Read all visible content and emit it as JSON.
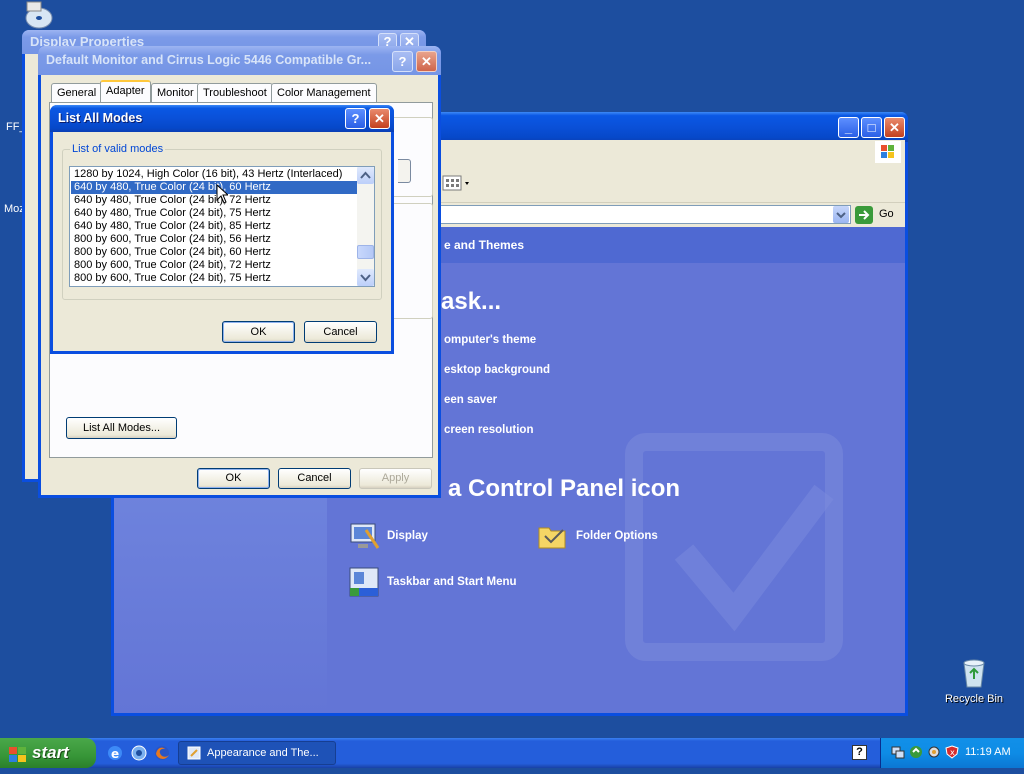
{
  "desktop": {
    "icons": [
      {
        "name": "recycle-bin",
        "label": "Recycle Bin"
      }
    ],
    "side_texts": [
      "FF_",
      "Moz"
    ]
  },
  "control_panel": {
    "window_buttons": [
      "_",
      "□",
      "✕"
    ],
    "address_go": "Go",
    "header": "e and Themes",
    "pick_task": "task...",
    "tasks": [
      "omputer's theme",
      "esktop background",
      "een saver",
      "creen resolution"
    ],
    "pick_icon": "a Control Panel icon",
    "icons": [
      {
        "label": "Display"
      },
      {
        "label": "Folder Options"
      },
      {
        "label": "Taskbar and Start Menu"
      }
    ]
  },
  "display_properties": {
    "title": "Display Properties"
  },
  "monitor_dialog": {
    "title": "Default Monitor and Cirrus Logic 5446 Compatible Gr...",
    "tabs": [
      "General",
      "Adapter",
      "Monitor",
      "Troubleshoot",
      "Color Management"
    ],
    "selected_tab": "Adapter",
    "list_all_modes_button": "List All Modes...",
    "ok": "OK",
    "cancel": "Cancel",
    "apply": "Apply"
  },
  "list_modes_dialog": {
    "title": "List All Modes",
    "group_label": "List of valid modes",
    "modes": [
      "1280 by 1024, High Color (16 bit), 43 Hertz (Interlaced)",
      "640 by 480, True Color (24 bit), 60 Hertz",
      "640 by 480, True Color (24 bit), 72 Hertz",
      "640 by 480, True Color (24 bit), 75 Hertz",
      "640 by 480, True Color (24 bit), 85 Hertz",
      "800 by 600, True Color (24 bit), 56 Hertz",
      "800 by 600, True Color (24 bit), 60 Hertz",
      "800 by 600, True Color (24 bit), 72 Hertz",
      "800 by 600, True Color (24 bit), 75 Hertz"
    ],
    "selected_index": 1,
    "ok": "OK",
    "cancel": "Cancel"
  },
  "taskbar": {
    "start": "start",
    "task": "Appearance and The...",
    "clock": "11:19 AM"
  },
  "colors": {
    "desktop": "#1d4e9f",
    "title_active": "#0a50d8",
    "control_panel_bg": "#6375d6",
    "selection": "#316ac5"
  }
}
